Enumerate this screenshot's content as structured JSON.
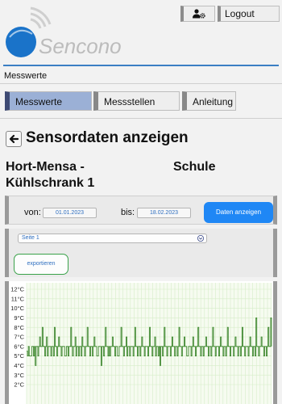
{
  "header": {
    "logo_text": "Sencono",
    "account_icon": "user-gear-icon",
    "logout_label": "Logout",
    "brand_color": "#1a73c9",
    "accent_line_color": "#3b7fc4"
  },
  "breadcrumb": "Messwerte",
  "tabs": [
    {
      "label": "Messwerte",
      "active": true
    },
    {
      "label": "Messstellen",
      "active": false
    },
    {
      "label": "Anleitung",
      "active": false
    }
  ],
  "page": {
    "back_icon": "arrow-left-icon",
    "title": "Sensordaten anzeigen",
    "sensor_name": "Hort-Mensa - Kühlschrank 1",
    "sensor_location": "Schule"
  },
  "filter": {
    "from_label": "von:",
    "from_value": "01.01.2023",
    "to_label": "bis:",
    "to_value": "18.02.2023",
    "show_button": "Daten anzeigen",
    "show_button_color": "#1f87f5"
  },
  "export": {
    "page_select": "Seite 1",
    "export_button": "exportieren",
    "export_border_color": "#3aa24a"
  },
  "chart_data": {
    "type": "line",
    "yticks": [
      "12°C",
      "11°C",
      "10°C",
      "9°C",
      "8°C",
      "7°C",
      "6°C",
      "5°C",
      "4°C",
      "3°C",
      "2°C"
    ],
    "ylim": [
      1.5,
      12.5
    ],
    "grid": true,
    "line_color": "#2e7d1e",
    "grid_color": "#d6edc8",
    "series": [
      {
        "values": [
          5.5,
          5,
          6,
          5,
          5,
          5,
          6,
          6,
          5,
          6,
          4,
          6,
          6,
          5,
          6,
          7,
          6,
          6,
          8,
          6,
          6,
          5,
          6,
          7,
          5,
          6,
          6,
          6,
          5,
          6,
          6,
          5,
          8,
          6,
          6,
          5,
          6,
          7,
          6,
          6,
          5,
          6,
          6,
          6,
          5,
          5,
          6,
          6,
          5,
          6,
          6,
          8,
          6,
          5,
          6,
          6,
          7,
          5,
          6,
          6,
          5,
          6,
          6,
          5,
          7,
          6,
          6,
          5,
          6,
          6,
          8,
          6,
          6,
          5,
          6,
          6,
          5,
          6,
          7,
          6,
          6,
          5,
          5,
          6,
          6,
          6,
          4,
          6,
          6,
          5,
          6,
          8,
          6,
          6,
          5,
          6,
          5,
          6,
          6,
          7,
          6,
          6,
          5,
          6,
          6,
          5,
          5,
          6,
          6,
          8,
          6,
          6,
          5,
          6,
          6,
          7,
          5,
          6,
          6,
          5,
          6,
          6,
          6,
          5,
          6,
          8,
          6,
          6,
          5,
          6,
          6,
          5,
          6,
          7,
          6,
          6,
          5,
          6,
          6,
          6,
          5,
          6,
          8,
          6,
          6,
          5,
          6,
          6,
          7,
          5,
          6,
          6,
          5,
          6,
          4,
          6,
          6,
          5,
          6,
          8,
          6,
          6,
          5,
          6,
          6,
          6,
          5,
          6,
          7,
          6,
          6,
          5,
          6,
          6,
          5,
          6,
          8,
          6,
          6,
          5,
          6,
          6,
          7,
          6,
          6,
          5,
          5,
          6,
          6,
          6,
          5,
          6,
          7,
          6,
          6,
          5,
          6,
          6,
          8,
          6,
          6,
          5,
          6,
          6,
          5,
          6,
          6,
          7,
          6,
          6,
          5,
          6,
          6,
          5,
          6,
          8,
          6,
          6,
          5,
          6,
          6,
          6,
          5,
          6,
          7,
          6,
          6,
          5,
          6,
          6,
          5,
          6,
          8,
          6,
          6,
          5,
          6,
          6,
          6,
          5,
          6,
          7,
          6,
          6,
          5,
          6,
          6,
          5,
          6,
          8,
          6,
          6,
          5,
          6,
          6,
          6,
          5,
          6,
          7,
          6,
          6,
          5,
          6,
          6,
          5,
          9,
          6,
          6,
          5,
          6,
          6,
          7,
          6,
          6,
          5,
          6,
          6,
          5,
          6,
          8,
          6,
          6,
          9,
          6
        ]
      }
    ]
  }
}
